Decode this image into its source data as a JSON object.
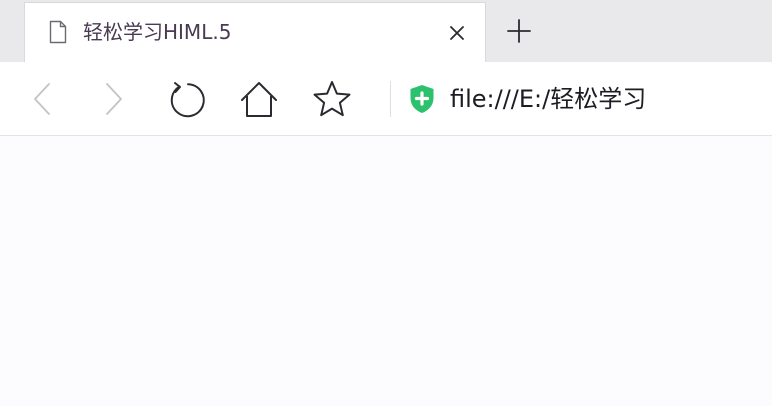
{
  "tab": {
    "title": "轻松学习HIML.5",
    "page_icon": "page-icon",
    "close_icon": "close-icon"
  },
  "new_tab": {
    "icon": "plus-icon"
  },
  "toolbar": {
    "back_icon": "chevron-left-icon",
    "forward_icon": "chevron-right-icon",
    "reload_icon": "reload-icon",
    "home_icon": "home-icon",
    "favorite_icon": "star-icon"
  },
  "address_bar": {
    "secure_icon": "shield-plus-icon",
    "url": "file:///E:/轻松学习"
  },
  "colors": {
    "tabstrip_bg": "#e9e9eb",
    "active_tab_bg": "#ffffff",
    "icon_stroke": "#2a2a30",
    "disabled_icon": "#c3c3c8",
    "secure_green": "#2bc16d",
    "page_bg": "#fcfcfe"
  }
}
